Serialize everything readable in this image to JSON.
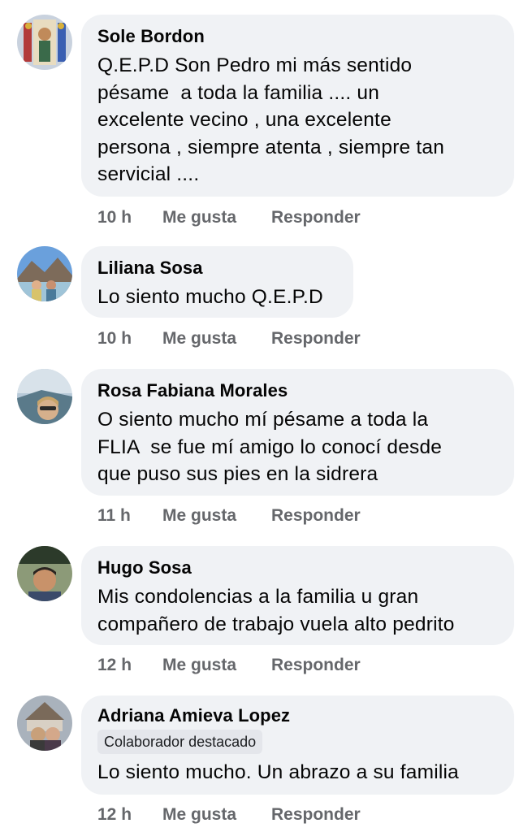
{
  "comments": [
    {
      "author": "Sole Bordon",
      "text": "Q.E.P.D Son Pedro mi más sentido\npésame  a toda la familia .... un\nexcelente vecino , una excelente\npersona , siempre atenta , siempre tan\nservicial ....",
      "time": "10 h",
      "like": "Me gusta",
      "reply": "Responder",
      "avatar_color": "#b8c4d6"
    },
    {
      "author": "Liliana Sosa",
      "text": "Lo siento mucho Q.E.P.D",
      "time": "10 h",
      "like": "Me gusta",
      "reply": "Responder",
      "avatar_color": "#5c8bc4"
    },
    {
      "author": "Rosa Fabiana Morales",
      "text": "O siento mucho mí pésame a toda la\nFLIA  se fue mí amigo lo conocí desde\nque puso sus pies en la sidrera",
      "time": "11 h",
      "like": "Me gusta",
      "reply": "Responder",
      "avatar_color": "#8fa7bd"
    },
    {
      "author": "Hugo Sosa",
      "text": "Mis condolencias a la familia u gran\ncompañero de trabajo vuela alto pedrito",
      "time": "12 h",
      "like": "Me gusta",
      "reply": "Responder",
      "avatar_color": "#6f7f62"
    },
    {
      "author": "Adriana Amieva Lopez",
      "badge": "Colaborador destacado",
      "text": "Lo siento mucho. Un abrazo a su familia",
      "time": "12 h",
      "like": "Me gusta",
      "reply": "Responder",
      "avatar_color": "#9aa3ad"
    }
  ]
}
